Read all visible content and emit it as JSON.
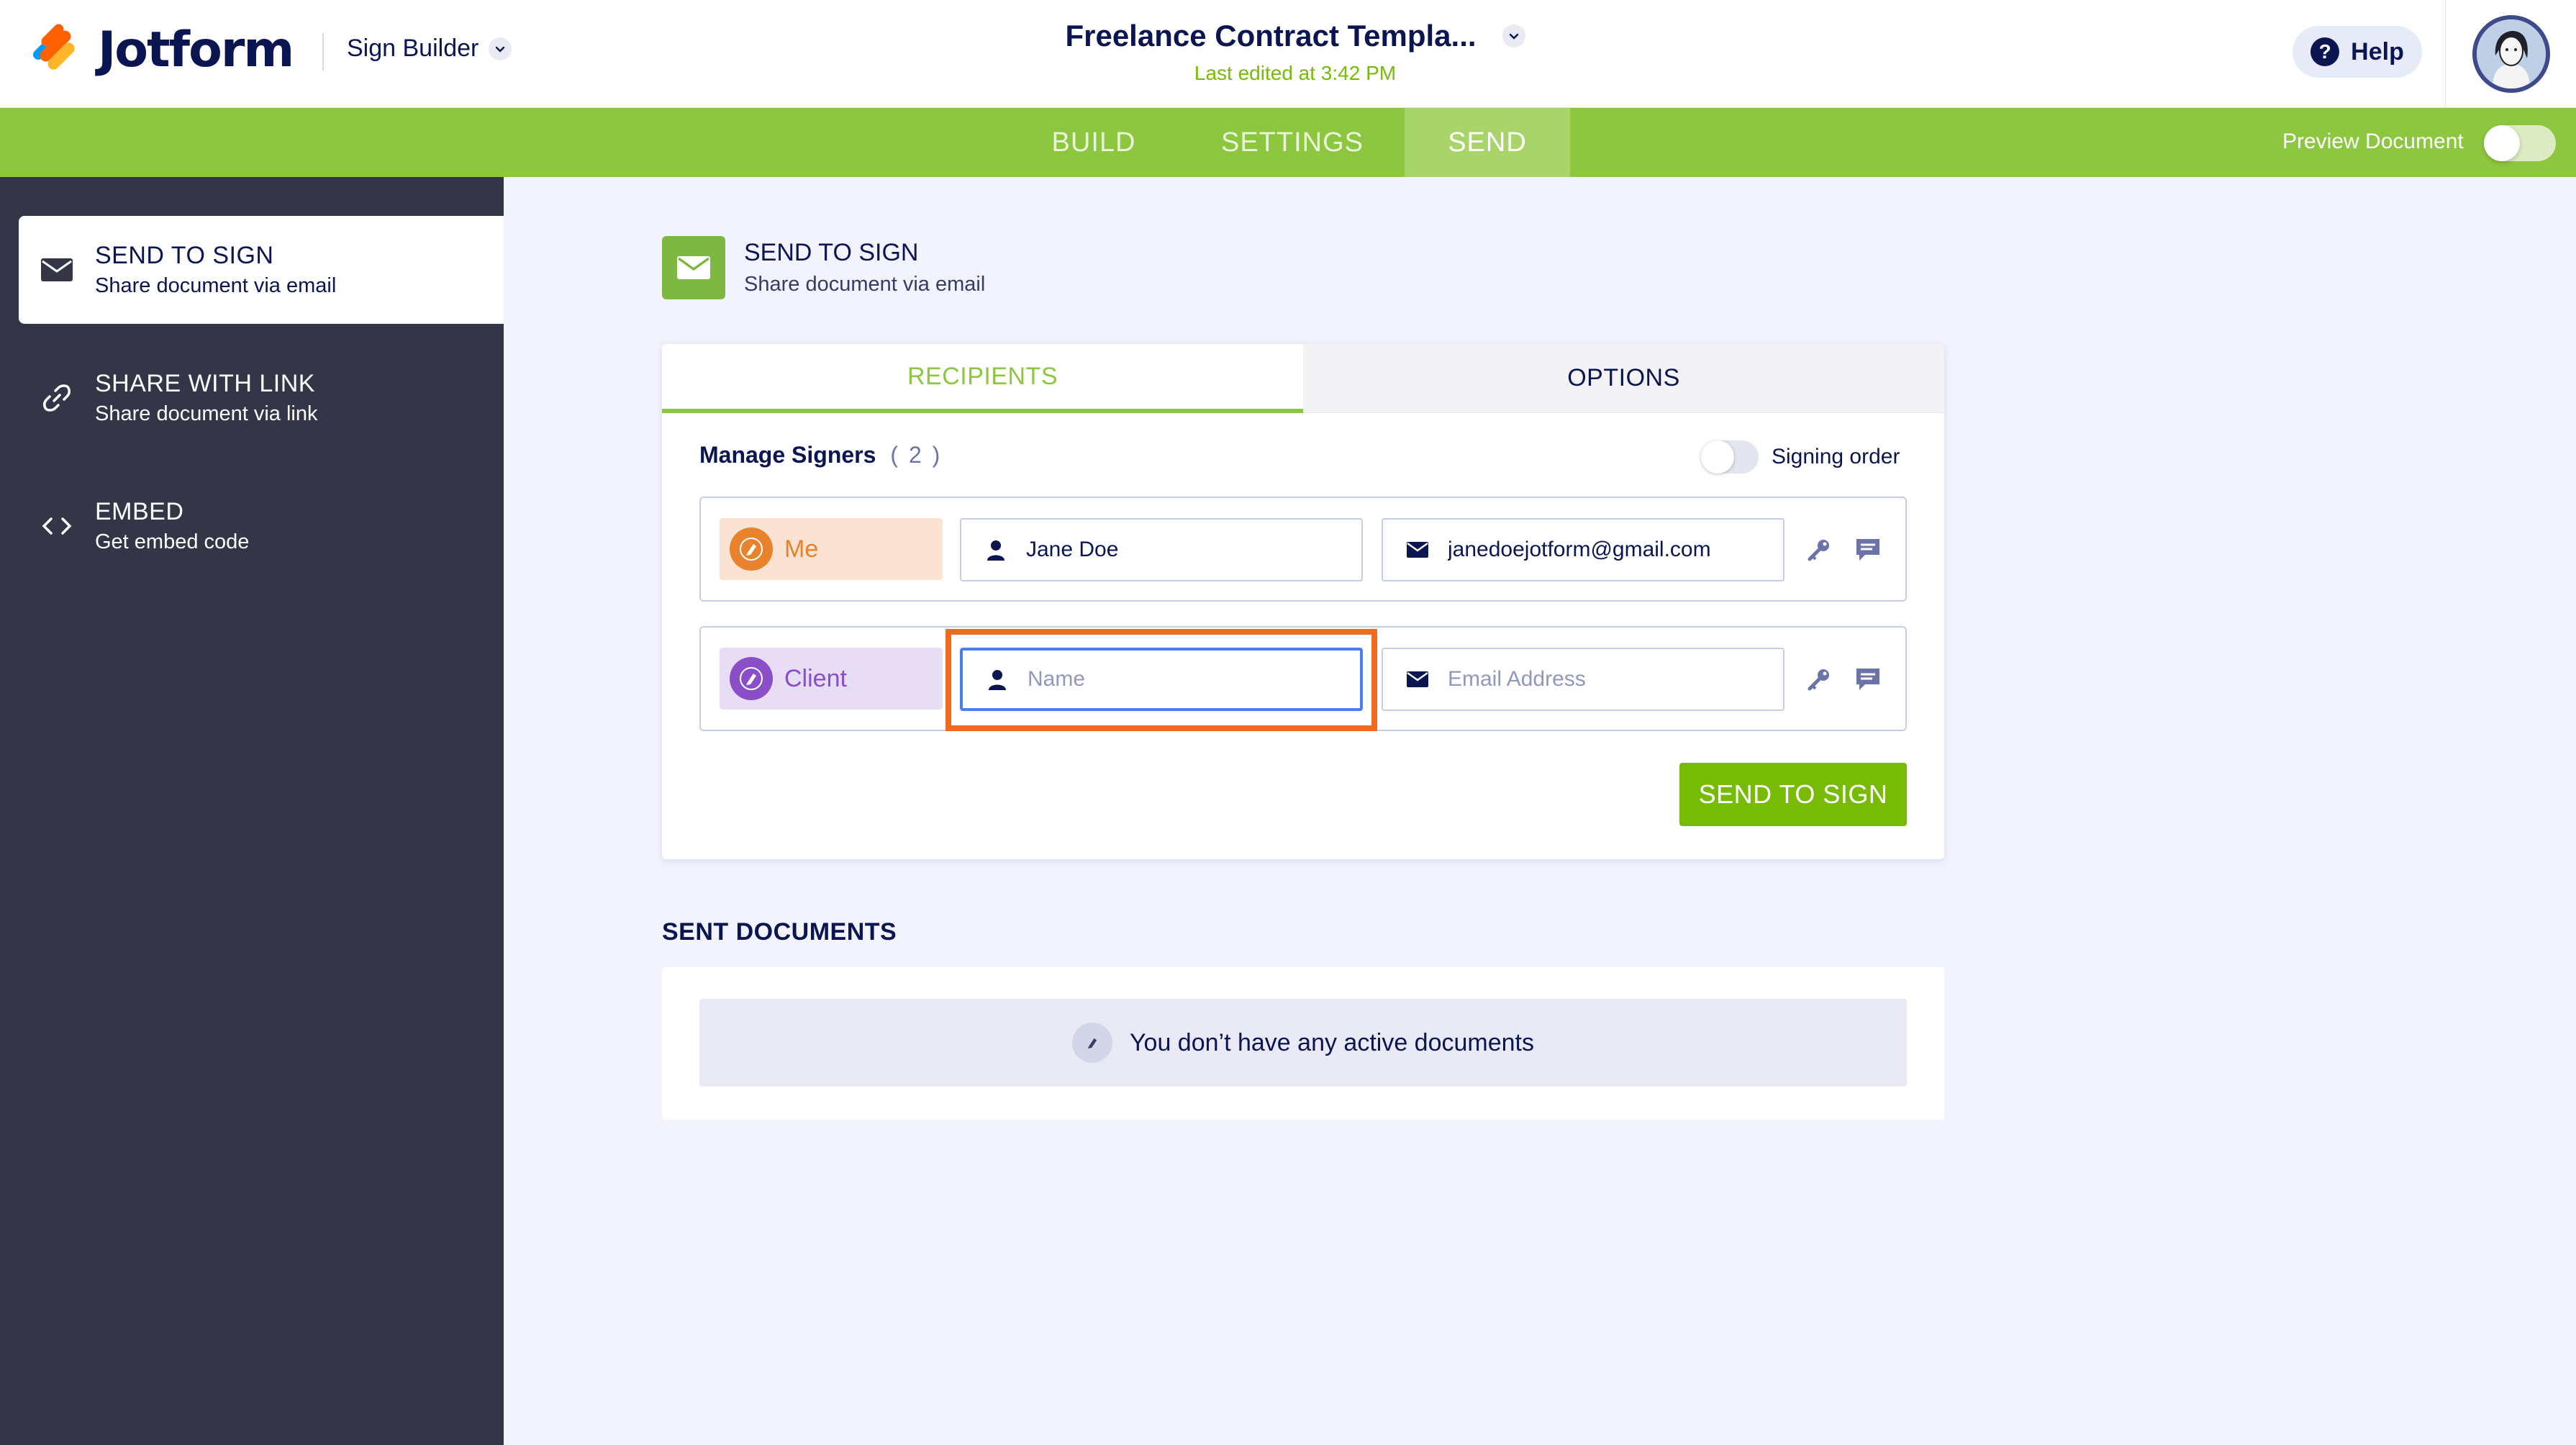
{
  "header": {
    "logo_text": "Jotform",
    "app_name": "Sign Builder",
    "doc_title": "Freelance Contract Templa...",
    "last_edited": "Last edited at 3:42 PM",
    "help_label": "Help"
  },
  "nav": {
    "tabs": [
      {
        "label": "BUILD",
        "active": false
      },
      {
        "label": "SETTINGS",
        "active": false
      },
      {
        "label": "SEND",
        "active": true
      }
    ],
    "preview_label": "Preview Document",
    "preview_on": false
  },
  "sidebar": {
    "items": [
      {
        "title": "SEND TO SIGN",
        "desc": "Share document via email",
        "icon": "envelope-icon",
        "active": true
      },
      {
        "title": "SHARE WITH LINK",
        "desc": "Share document via link",
        "icon": "link-icon",
        "active": false
      },
      {
        "title": "EMBED",
        "desc": "Get embed code",
        "icon": "code-icon",
        "active": false
      }
    ]
  },
  "section": {
    "title": "SEND TO SIGN",
    "desc": "Share document via email",
    "icon": "envelope-icon"
  },
  "card": {
    "tabs": {
      "recipients": "RECIPIENTS",
      "options": "OPTIONS"
    },
    "manage_label": "Manage Signers",
    "signer_count": "( 2 )",
    "signing_order_label": "Signing order",
    "signing_order_on": false,
    "signers": [
      {
        "role": "Me",
        "name_value": "Jane Doe",
        "email_value": "janedoejotform@gmail.com"
      },
      {
        "role": "Client",
        "name_value": "",
        "name_placeholder": "Name",
        "email_value": "",
        "email_placeholder": "Email Address"
      }
    ],
    "send_button": "SEND TO SIGN"
  },
  "sent": {
    "title": "SENT DOCUMENTS",
    "empty_message": "You don’t have any active documents"
  },
  "colors": {
    "brand_green": "#8DC63F",
    "button_green": "#78BB07",
    "sidebar_bg": "#343648",
    "highlight": "#F06A22",
    "me_accent": "#E8822C",
    "client_accent": "#8A4FC8"
  }
}
